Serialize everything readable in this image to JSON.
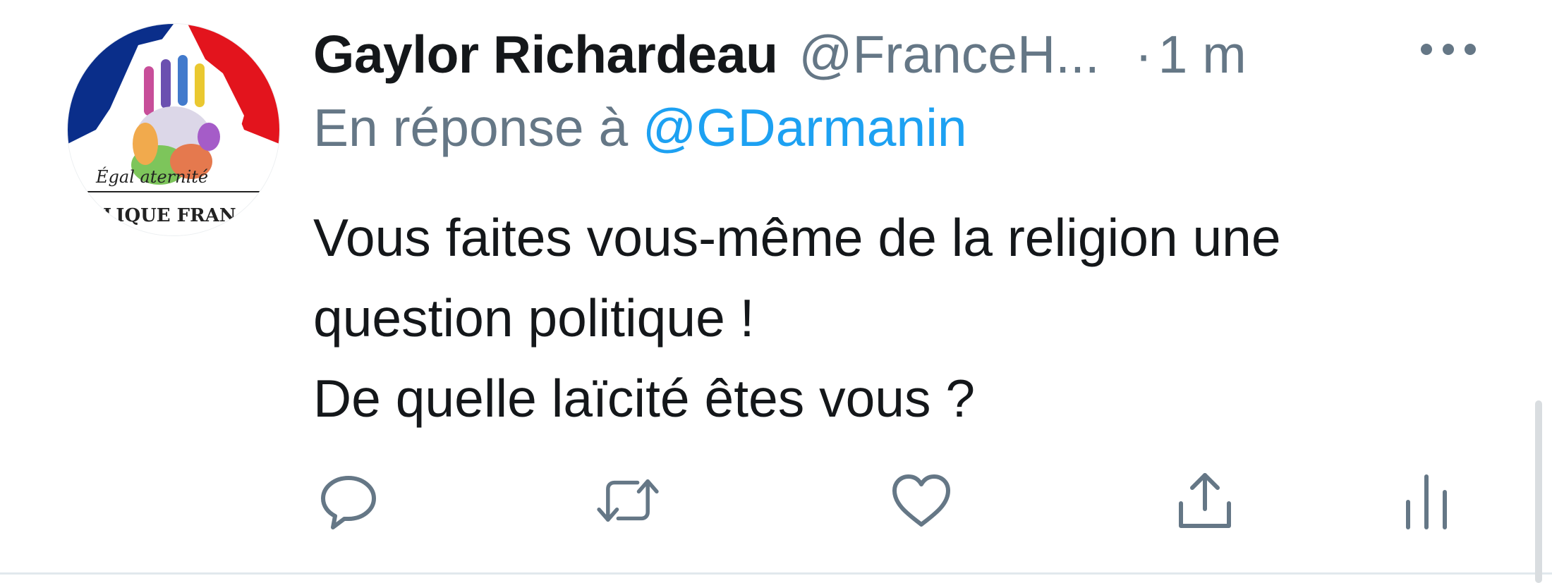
{
  "tweet": {
    "author_name": "Gaylor Richardeau",
    "author_handle": "@FranceH...",
    "separator": "·",
    "time": "1 m",
    "reply_prefix": "En réponse à",
    "reply_mention": "@GDarmanin",
    "body_lines": [
      "Vous faites vous-même de la religion une",
      "question politique !",
      "De quelle laïcité êtes vous ?"
    ]
  },
  "avatar": {
    "text_top": "Égalité Fraternité",
    "text_bottom": "RÉPUBLIQUE FRANÇAISE",
    "colors": {
      "blue": "#0a2e8a",
      "red": "#e3141d"
    }
  },
  "icons": {
    "more": "more-horizontal-icon",
    "reply": "reply-bubble-icon",
    "retweet": "retweet-icon",
    "like": "heart-icon",
    "share": "share-upload-icon",
    "analytics": "analytics-bars-icon"
  },
  "colors": {
    "text": "#14171a",
    "secondary": "#657786",
    "accent": "#1da1f2",
    "divider": "#e1e8ed"
  }
}
